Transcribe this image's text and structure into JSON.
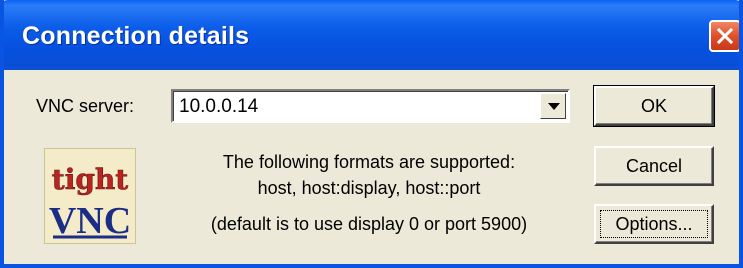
{
  "window": {
    "title": "Connection details"
  },
  "form": {
    "server_label": "VNC server:",
    "server_value": "10.0.0.14"
  },
  "logo": {
    "top_text": "tight",
    "bottom_text": "VNC"
  },
  "help": {
    "line1": "The following formats are supported:",
    "line2": "host,  host:display,  host::port",
    "line3": "(default is to use display 0 or port 5900)"
  },
  "buttons": {
    "ok": "OK",
    "cancel": "Cancel",
    "options": "Options..."
  },
  "icons": {
    "close": "close-icon",
    "dropdown": "chevron-down-icon",
    "logo": "tightvnc-logo"
  },
  "colors": {
    "titlebar": "#0a54e3",
    "dialog_bg": "#ece9d8",
    "close_button": "#e0502a",
    "logo_red": "#b8241f",
    "logo_blue": "#1c2d86"
  }
}
